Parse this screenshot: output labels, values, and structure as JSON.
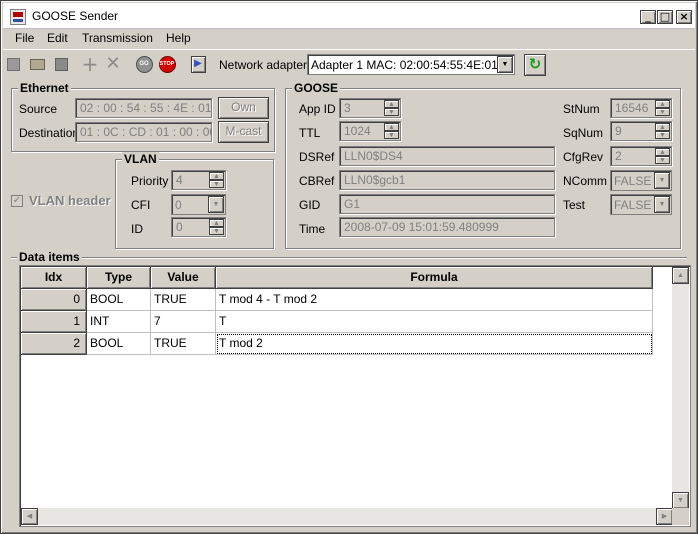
{
  "window": {
    "title": "GOOSE Sender"
  },
  "title_buttons": {
    "minimize": "_",
    "maximize": "□",
    "close": "×"
  },
  "menu": {
    "file": "File",
    "edit": "Edit",
    "transmission": "Transmission",
    "help": "Help"
  },
  "toolbar": {
    "go_text": "GO",
    "stop_text": "STOP",
    "network_adapter_label": "Network adapter",
    "adapter_value": "Adapter 1 MAC: 02:00:54:55:4E:01",
    "icons": [
      "new-icon",
      "open-folder-icon",
      "save-icon",
      "add-icon",
      "delete-icon",
      "go-icon",
      "stop-icon",
      "exit-door-icon",
      "refresh-icon"
    ]
  },
  "ethernet": {
    "title": "Ethernet",
    "source_label": "Source",
    "source_value": "02 : 00 : 54 : 55 : 4E : 01",
    "own_button": "Own",
    "destination_label": "Destination",
    "destination_value": "01 : 0C : CD : 01 : 00 : 00",
    "mcast_button": "M-cast"
  },
  "vlan": {
    "header_label": "VLAN header",
    "header_checked": true,
    "title": "VLAN",
    "priority_label": "Priority",
    "priority_value": "4",
    "cfi_label": "CFI",
    "cfi_value": "0",
    "id_label": "ID",
    "id_value": "0"
  },
  "goose": {
    "title": "GOOSE",
    "appid_label": "App ID",
    "appid_value": "3",
    "ttl_label": "TTL",
    "ttl_value": "1024",
    "dsref_label": "DSRef",
    "dsref_value": "LLN0$DS4",
    "cbref_label": "CBRef",
    "cbref_value": "LLN0$gcb1",
    "gid_label": "GID",
    "gid_value": "G1",
    "time_label": "Time",
    "time_value": "2008-07-09 15:01:59.480999",
    "stnum_label": "StNum",
    "stnum_value": "16546",
    "sqnum_label": "SqNum",
    "sqnum_value": "9",
    "cfgrev_label": "CfgRev",
    "cfgrev_value": "2",
    "ncomm_label": "NComm",
    "ncomm_value": "FALSE",
    "test_label": "Test",
    "test_value": "FALSE"
  },
  "data_items": {
    "title": "Data items",
    "columns": [
      "Idx",
      "Type",
      "Value",
      "Formula"
    ],
    "rows": [
      {
        "idx": "0",
        "type": "BOOL",
        "value": "TRUE",
        "formula": "T mod 4 - T mod 2"
      },
      {
        "idx": "1",
        "type": "INT",
        "value": "7",
        "formula": "T"
      },
      {
        "idx": "2",
        "type": "BOOL",
        "value": "TRUE",
        "formula": "T mod 2"
      }
    ]
  },
  "scroll_arrows": {
    "up": "▲",
    "down": "▼",
    "left": "◀",
    "right": "▶"
  }
}
